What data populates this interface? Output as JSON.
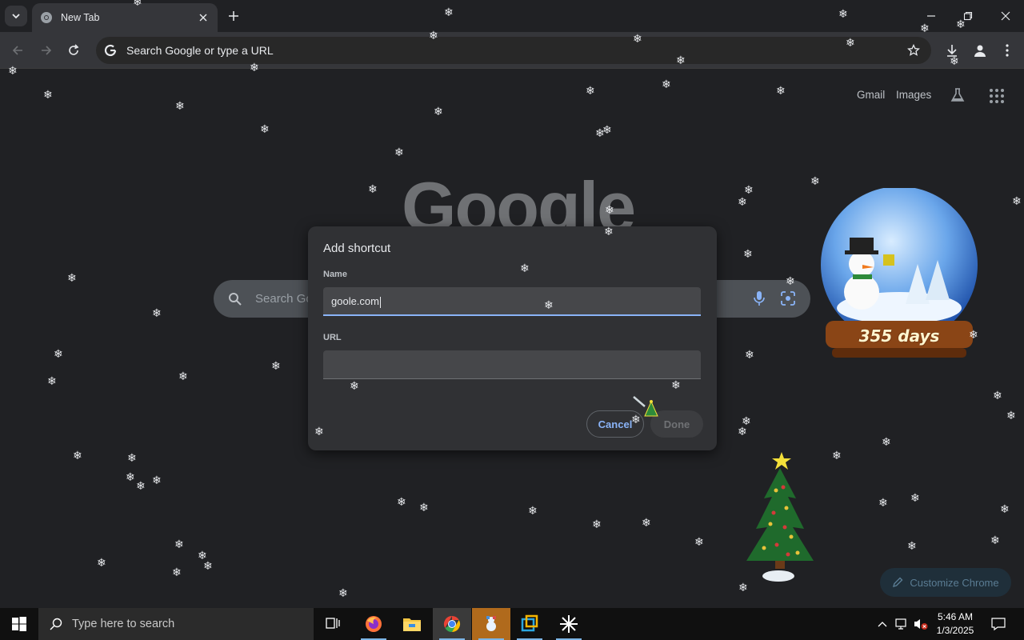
{
  "browser": {
    "tab_title": "New Tab",
    "omnibox_placeholder": "Search Google or type a URL"
  },
  "ntp": {
    "links": [
      "Gmail",
      "Images"
    ],
    "logo_text": "Google",
    "search_placeholder": "Search Google or type a URL",
    "customize_label": "Customize Chrome"
  },
  "dialog": {
    "title": "Add shortcut",
    "name_label": "Name",
    "name_value": "goole.com",
    "url_label": "URL",
    "url_value": "",
    "cancel_label": "Cancel",
    "done_label": "Done"
  },
  "widget": {
    "countdown": "355 days"
  },
  "taskbar": {
    "search_placeholder": "Type here to search",
    "time": "5:46 AM",
    "date": "1/3/2025"
  },
  "colors": {
    "accent": "#8ab4f8",
    "background": "#202124",
    "dialog_bg": "#303134"
  }
}
